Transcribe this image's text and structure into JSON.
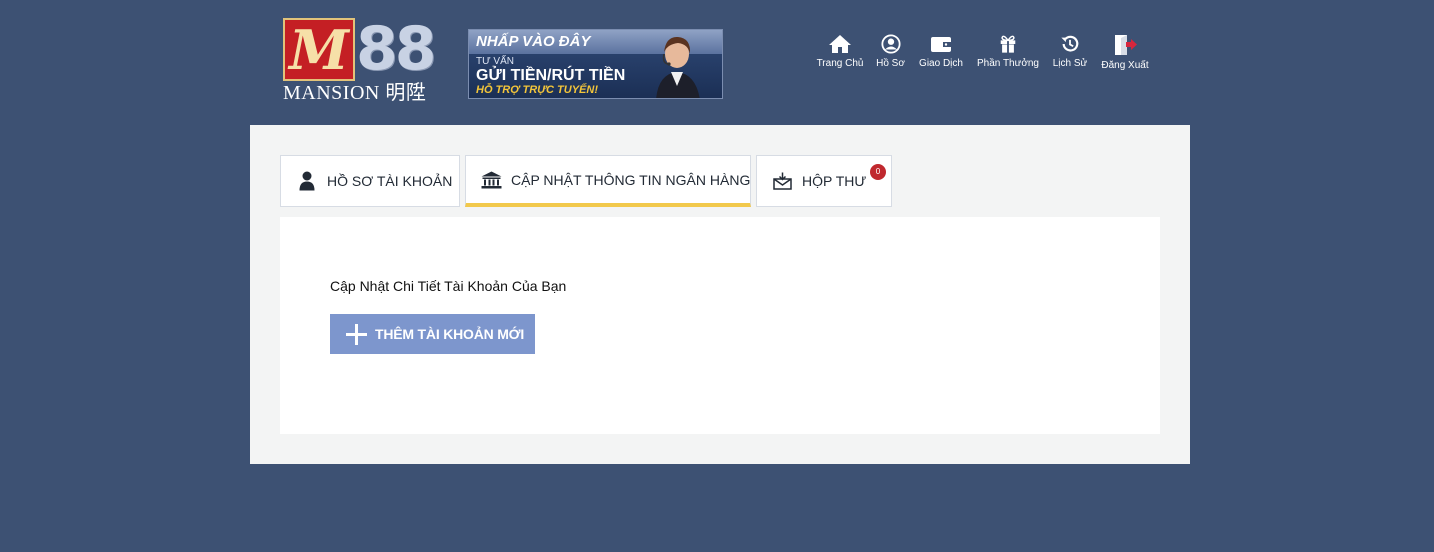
{
  "logo": {
    "mark": "M",
    "digits": "88",
    "word": "MANSION 明陞"
  },
  "banner": {
    "line1": "NHẤP VÀO ĐÂY",
    "line2": "TƯ VẤN",
    "line3": "GỬI TIỀN/RÚT TIỀN",
    "line4": "HỖ TRỢ TRỰC TUYẾN!"
  },
  "nav": {
    "items": [
      {
        "label": "Trang Chủ",
        "icon": "home-icon"
      },
      {
        "label": "Hồ Sơ",
        "icon": "profile-icon"
      },
      {
        "label": "Giao Dịch",
        "icon": "wallet-icon"
      },
      {
        "label": "Phần Thưởng",
        "icon": "gift-icon"
      },
      {
        "label": "Lịch Sử",
        "icon": "history-icon"
      },
      {
        "label": "Đăng Xuất",
        "icon": "logout-icon"
      }
    ]
  },
  "tabs": [
    {
      "label": "HỒ SƠ TÀI KHOẢN",
      "icon": "user-icon",
      "active": false
    },
    {
      "label": "CẬP NHẬT THÔNG TIN NGÂN HÀNG",
      "icon": "bank-icon",
      "active": true
    },
    {
      "label": "HỘP THƯ",
      "icon": "mail-icon",
      "active": false,
      "badge": "0"
    }
  ],
  "content": {
    "title": "Cập Nhật Chi Tiết Tài Khoản Của Bạn",
    "add_button": "THÊM TÀI KHOẢN MỚI"
  },
  "colors": {
    "background": "#3d5173",
    "panel": "#f3f4f4",
    "active_tab_underline": "#f2c94c",
    "button": "#7d96cd",
    "badge": "#c0282e"
  }
}
